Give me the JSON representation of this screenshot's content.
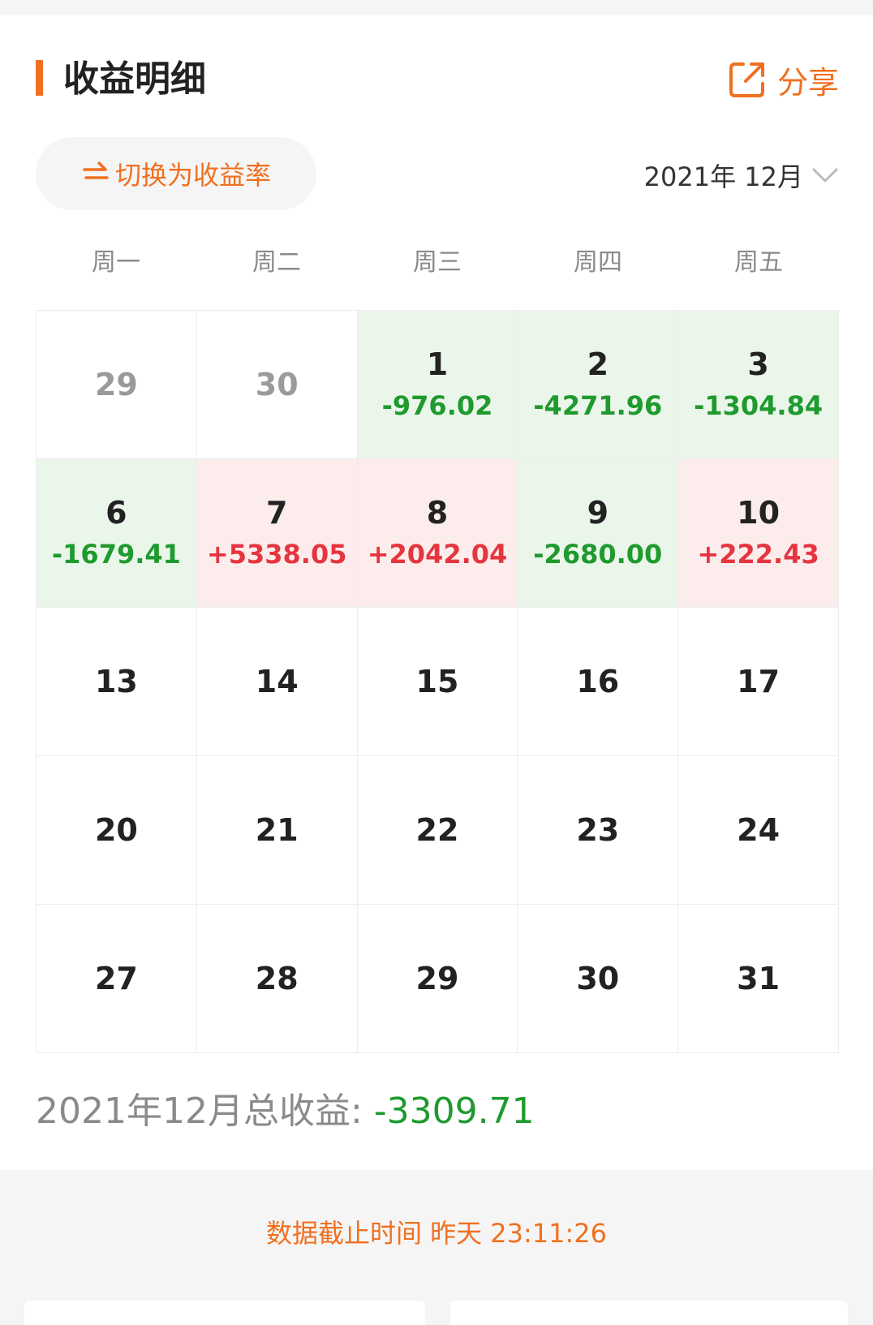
{
  "header": {
    "title": "收益明细",
    "share_label": "分享",
    "share_icon": "share-icon",
    "accent_color": "#f0701f"
  },
  "controls": {
    "switch_label": "切换为收益率",
    "switch_icon": "swap-arrows-icon",
    "month_label": "2021年 12月",
    "month_icon": "chevron-down-icon"
  },
  "weekdays": [
    "周一",
    "周二",
    "周三",
    "周四",
    "周五"
  ],
  "calendar": {
    "cells": [
      {
        "day": "29",
        "value": "",
        "state": "other"
      },
      {
        "day": "30",
        "value": "",
        "state": "other"
      },
      {
        "day": "1",
        "value": "-976.02",
        "state": "down"
      },
      {
        "day": "2",
        "value": "-4271.96",
        "state": "down"
      },
      {
        "day": "3",
        "value": "-1304.84",
        "state": "down"
      },
      {
        "day": "6",
        "value": "-1679.41",
        "state": "down"
      },
      {
        "day": "7",
        "value": "+5338.05",
        "state": "up"
      },
      {
        "day": "8",
        "value": "+2042.04",
        "state": "up"
      },
      {
        "day": "9",
        "value": "-2680.00",
        "state": "down"
      },
      {
        "day": "10",
        "value": "+222.43",
        "state": "up"
      },
      {
        "day": "13",
        "value": "",
        "state": "normal"
      },
      {
        "day": "14",
        "value": "",
        "state": "normal"
      },
      {
        "day": "15",
        "value": "",
        "state": "normal"
      },
      {
        "day": "16",
        "value": "",
        "state": "normal"
      },
      {
        "day": "17",
        "value": "",
        "state": "normal"
      },
      {
        "day": "20",
        "value": "",
        "state": "normal"
      },
      {
        "day": "21",
        "value": "",
        "state": "normal"
      },
      {
        "day": "22",
        "value": "",
        "state": "normal"
      },
      {
        "day": "23",
        "value": "",
        "state": "normal"
      },
      {
        "day": "24",
        "value": "",
        "state": "normal"
      },
      {
        "day": "27",
        "value": "",
        "state": "normal"
      },
      {
        "day": "28",
        "value": "",
        "state": "normal"
      },
      {
        "day": "29",
        "value": "",
        "state": "normal"
      },
      {
        "day": "30",
        "value": "",
        "state": "normal"
      },
      {
        "day": "31",
        "value": "",
        "state": "normal"
      }
    ],
    "colors": {
      "loss_text": "#1f9a2e",
      "loss_bg": "#ebf6ea",
      "gain_text": "#e5353f",
      "gain_bg": "#fdecec"
    }
  },
  "summary": {
    "label": "2021年12月总收益: ",
    "value": "-3309.71"
  },
  "footer": {
    "note": "数据截止时间 昨天 23:11:26"
  }
}
